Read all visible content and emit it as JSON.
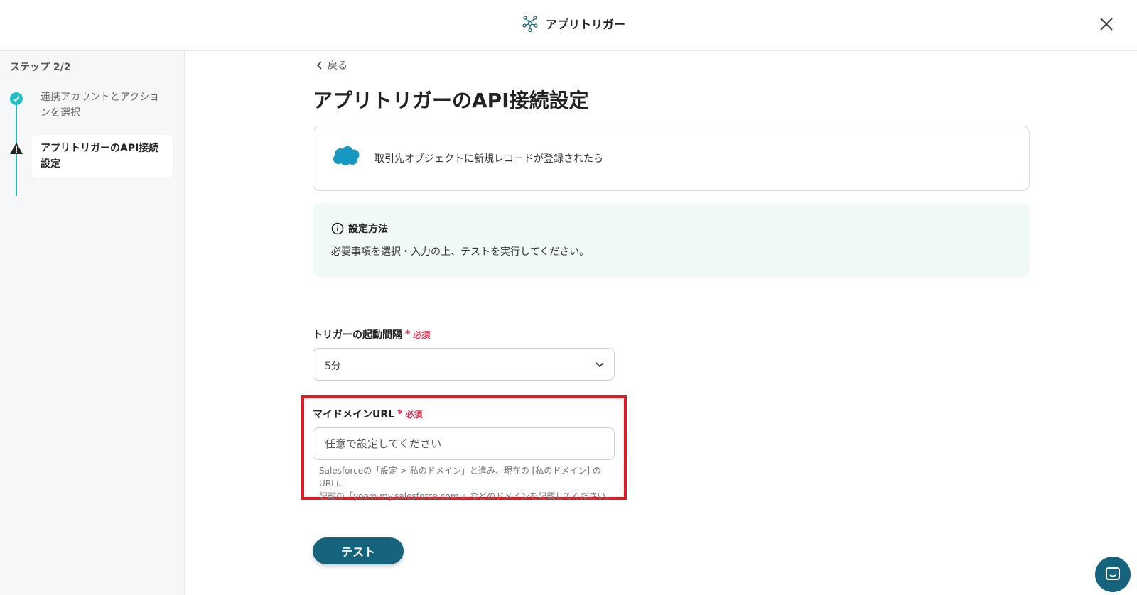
{
  "header": {
    "title": "アプリトリガー",
    "title_icon": "node-network-icon",
    "close_icon": "close-icon"
  },
  "sidebar": {
    "step_header": "ステップ 2/2",
    "steps": [
      {
        "label": "連携アカウントとアクションを選択",
        "status": "done",
        "icon": "check-circle-icon"
      },
      {
        "label": "アプリトリガーのAPI接続設定",
        "status": "current",
        "icon": "warning-icon"
      }
    ]
  },
  "main": {
    "back_label": "戻る",
    "page_title": "アプリトリガーのAPI接続設定",
    "trigger": {
      "app_icon": "salesforce-cloud-icon",
      "text": "取引先オブジェクトに新規レコードが登録されたら"
    },
    "info": {
      "icon": "info-icon",
      "title": "設定方法",
      "description": "必要事項を選択・入力の上、テストを実行してください。"
    },
    "interval_field": {
      "label": "トリガーの起動間隔",
      "required_star": "*",
      "required_text": "必須",
      "selected": "5分"
    },
    "domain_field": {
      "label": "マイドメインURL",
      "required_star": "*",
      "required_text": "必須",
      "value": "",
      "placeholder": "任意で設定してください",
      "help_line1": "Salesforceの「設定 > 私のドメイン」と進み、現在の [私のドメイン] の URLに",
      "help_line2": "記載の「yoom.my.salesforce.com 」などのドメインを記載してください。"
    },
    "test_button": "テスト"
  },
  "colors": {
    "accent_teal": "#1fb6be",
    "button_dark_teal": "#15637c",
    "required_red": "#e3344d",
    "highlight_red": "#e01b24",
    "info_bg": "#f1f9f8",
    "salesforce_blue": "#1798c1"
  }
}
